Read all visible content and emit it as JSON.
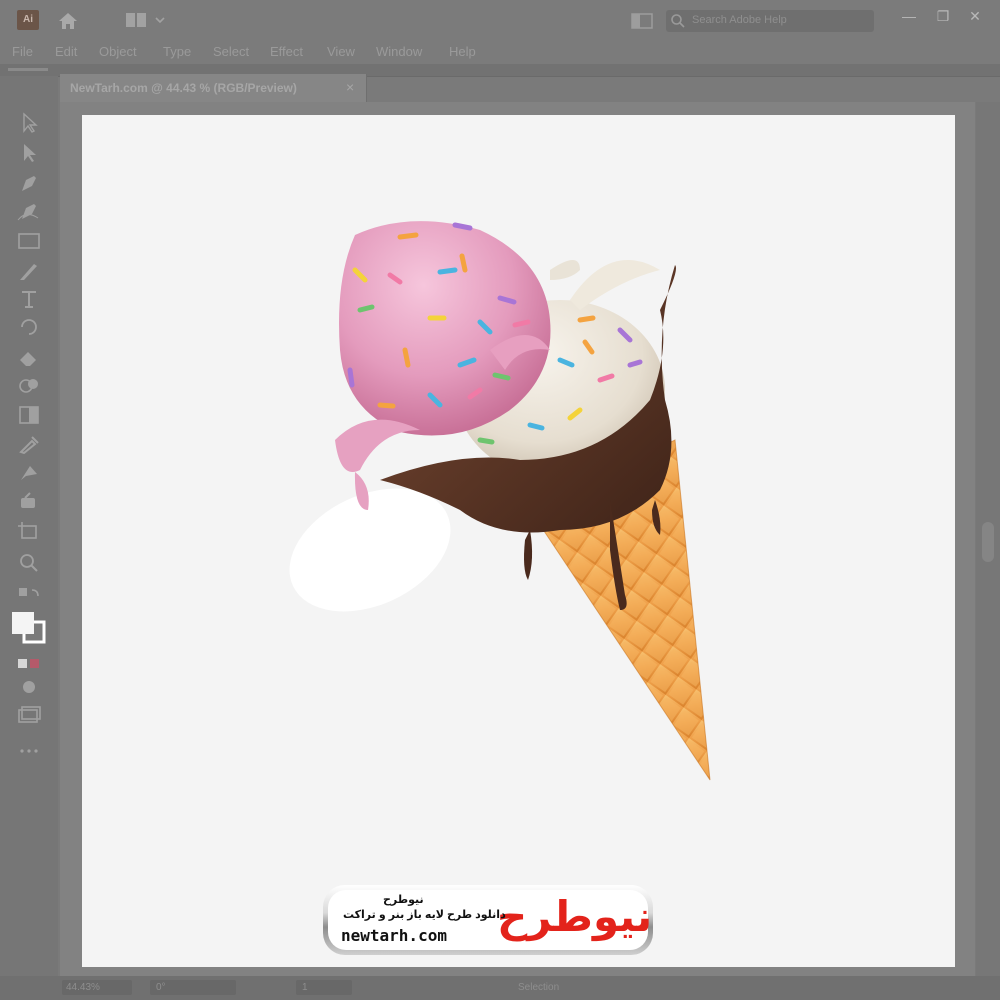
{
  "app": {
    "logo_text": "Ai"
  },
  "search": {
    "placeholder": "Search Adobe Help"
  },
  "window_controls": {
    "minimize": "—",
    "maximize": "❐",
    "close": "✕"
  },
  "menu": [
    "File",
    "Edit",
    "Object",
    "Type",
    "Select",
    "Effect",
    "View",
    "Window",
    "Help"
  ],
  "document": {
    "tab_title": "NewTarh.com @ 44.43 % (RGB/Preview)",
    "close": "×"
  },
  "status": {
    "zoom": "44.43%",
    "rotation": "0°",
    "artboard_number": "1",
    "tool": "Selection"
  },
  "watermark": {
    "logo_fa": "نیوطرح",
    "brand_fa": "نیوطرح",
    "tagline_fa": "دانلود طرح لایه باز بنر و تراکت",
    "url": "newtarh.com"
  },
  "colors": {
    "chrome": "#7b7b7b",
    "artboard": "#f4f4f4",
    "strawberry": "#e8a6c4",
    "vanilla": "#ece6dc",
    "chocolate": "#5a3526",
    "cone": "#f0a24a",
    "badge_red": "#e3231b"
  },
  "icons": {
    "home": "home-icon",
    "layout": "workspace-layout-icon",
    "arrange": "arrange-documents-icon",
    "search": "search-icon",
    "tools": [
      "selection-tool-icon",
      "direct-selection-tool-icon",
      "pen-tool-icon",
      "curvature-tool-icon",
      "rectangle-tool-icon",
      "brush-tool-icon",
      "type-tool-icon",
      "rotate-tool-icon",
      "eraser-tool-icon",
      "shape-builder-icon",
      "gradient-tool-icon",
      "eyedropper-tool-icon",
      "blend-tool-icon",
      "symbol-sprayer-icon",
      "artboard-tool-icon",
      "zoom-tool-icon",
      "swap-colors-icon",
      "fill-stroke-icon",
      "color-mode-icon",
      "draw-mode-icon",
      "screen-mode-icon",
      "more-tools-icon"
    ]
  }
}
